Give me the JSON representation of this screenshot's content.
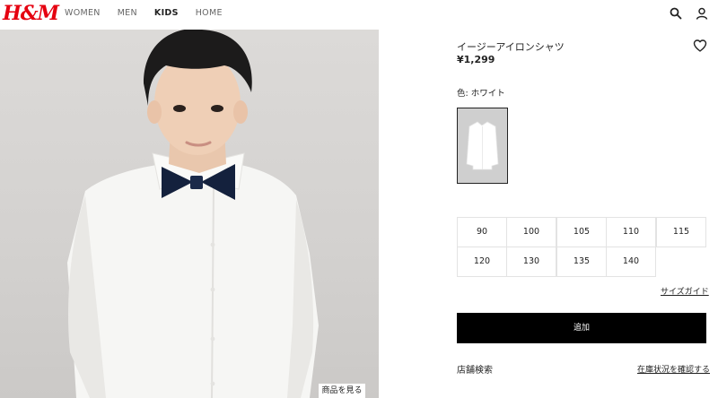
{
  "header": {
    "logo": "H&M",
    "nav": [
      "WOMEN",
      "MEN",
      "KIDS",
      "HOME"
    ],
    "active_nav": "KIDS",
    "icons": [
      "search-icon",
      "account-icon"
    ]
  },
  "product": {
    "title": "イージーアイロンシャツ",
    "price": "¥1,299",
    "color_label": "色: ホワイト",
    "view_button": "商品を見る"
  },
  "sizes": [
    "90",
    "100",
    "105",
    "110",
    "115",
    "120",
    "130",
    "135",
    "140"
  ],
  "actions": {
    "size_guide": "サイズガイド",
    "add": "追加",
    "store_search": "店舗検索",
    "check_stock": "在庫状況を確認する"
  },
  "colors": {
    "brand": "#e50010",
    "button": "#000000"
  }
}
